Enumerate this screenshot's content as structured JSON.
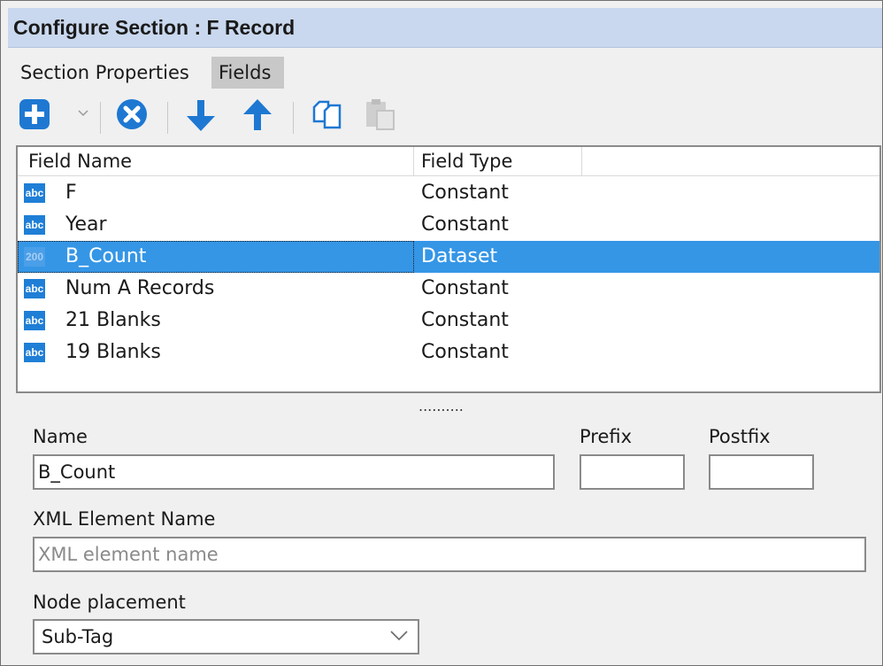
{
  "window": {
    "title": "Configure Section : F Record"
  },
  "tabs": [
    {
      "label": "Section Properties"
    },
    {
      "label": "Fields"
    }
  ],
  "toolbar": {
    "icons": [
      "add-icon",
      "dropdown-arrow-icon",
      "delete-icon",
      "move-down-icon",
      "move-up-icon",
      "copy-icon",
      "paste-icon"
    ],
    "accent": "#1e78d2"
  },
  "grid": {
    "columns": [
      "Field Name",
      "Field Type"
    ],
    "rows": [
      {
        "icon": "abc",
        "name": "F",
        "type": "Constant"
      },
      {
        "icon": "abc",
        "name": "Year",
        "type": "Constant"
      },
      {
        "icon": "200",
        "name": "B_Count",
        "type": "Dataset",
        "selected": true
      },
      {
        "icon": "abc",
        "name": "Num A Records",
        "type": "Constant"
      },
      {
        "icon": "abc",
        "name": "21 Blanks",
        "type": "Constant"
      },
      {
        "icon": "abc",
        "name": "19 Blanks",
        "type": "Constant"
      }
    ],
    "selection_color": "#3596e6"
  },
  "splitter": "..........",
  "form": {
    "name_label": "Name",
    "name_value": "B_Count",
    "prefix_label": "Prefix",
    "prefix_value": "",
    "postfix_label": "Postfix",
    "postfix_value": "",
    "xml_label": "XML Element Name",
    "xml_value": "",
    "xml_placeholder": "XML element name",
    "node_label": "Node placement",
    "node_value": "Sub-Tag"
  }
}
